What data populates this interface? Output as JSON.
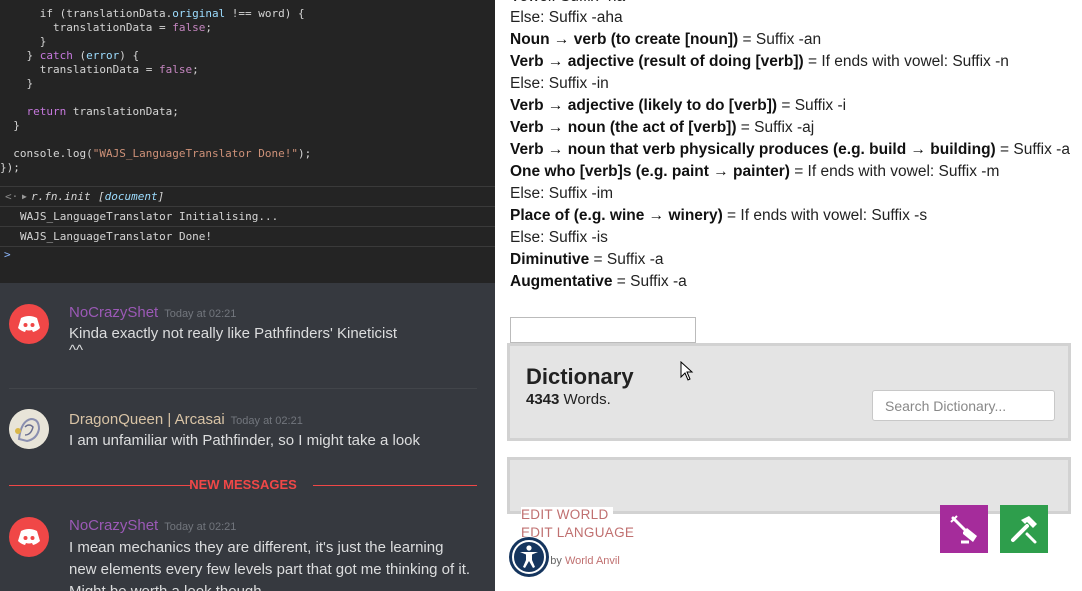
{
  "console": {
    "code_lines": [
      {
        "indent": "      ",
        "parts": [
          [
            "if (translationData.",
            ""
          ],
          [
            "original",
            "prop"
          ],
          [
            " !== word) {",
            ""
          ]
        ]
      },
      {
        "indent": "        ",
        "parts": [
          [
            "translationData = ",
            ""
          ],
          [
            "false",
            "bool"
          ],
          [
            ";",
            ""
          ]
        ]
      },
      {
        "indent": "      ",
        "parts": [
          [
            "}",
            ""
          ]
        ]
      },
      {
        "indent": "    ",
        "parts": [
          [
            "} ",
            ""
          ],
          [
            "catch",
            "kw"
          ],
          [
            " (",
            ""
          ],
          [
            "error",
            "prop"
          ],
          [
            ") {",
            ""
          ]
        ]
      },
      {
        "indent": "      ",
        "parts": [
          [
            "translationData = ",
            ""
          ],
          [
            "false",
            "bool"
          ],
          [
            ";",
            ""
          ]
        ]
      },
      {
        "indent": "    ",
        "parts": [
          [
            "}",
            ""
          ]
        ]
      },
      {
        "indent": "",
        "parts": [
          [
            "",
            ""
          ]
        ]
      },
      {
        "indent": "    ",
        "parts": [
          [
            "return",
            "kw"
          ],
          [
            " translationData;",
            ""
          ]
        ]
      },
      {
        "indent": "  ",
        "parts": [
          [
            "}",
            ""
          ]
        ]
      },
      {
        "indent": "",
        "parts": [
          [
            "",
            ""
          ]
        ]
      },
      {
        "indent": "  ",
        "parts": [
          [
            "console.",
            ""
          ],
          [
            "log",
            ""
          ],
          [
            "(",
            ""
          ],
          [
            "\"WAJS_LanguageTranslator Done!\"",
            "str"
          ],
          [
            ");",
            ""
          ]
        ]
      },
      {
        "indent": "",
        "parts": [
          [
            "});",
            ""
          ]
        ]
      }
    ],
    "result_prefix": "r.fn.init",
    "result_type": "document",
    "output_lines": [
      "WAJS_LanguageTranslator Initialising...",
      "WAJS_LanguageTranslator Done!"
    ],
    "prompt": ">"
  },
  "chat": {
    "messages": [
      {
        "username": "NoCrazyShet",
        "time": "Today at 02:21",
        "lines": [
          "Kinda exactly not really like Pathfinders' Kineticist",
          "^^"
        ]
      },
      {
        "username": "DragonQueen | Arcasai",
        "time": "Today at 02:21",
        "lines": [
          "I am unfamiliar with Pathfinder, so I might take a look"
        ]
      },
      {
        "username": "NoCrazyShet",
        "time": "Today at 02:21",
        "lines": [
          "I mean mechanics they are different, it's just the learning",
          "new elements every few levels part that got me thinking of it.",
          "Might be worth a look though"
        ]
      }
    ],
    "new_messages_label": "NEW MESSAGES"
  },
  "rules": [
    {
      "bold": "",
      "rest": "Else: Suffix -aha"
    },
    {
      "bold": "Noun → verb (to create [noun])",
      "rest": " = Suffix -an"
    },
    {
      "bold": "Verb → adjective (result of doing [verb])",
      "rest": " = If ends with vowel: Suffix -n"
    },
    {
      "bold": "",
      "rest": "Else: Suffix -in"
    },
    {
      "bold": "Verb → adjective (likely to do [verb])",
      "rest": " = Suffix -i"
    },
    {
      "bold": "Verb → noun (the act of [verb])",
      "rest": " = Suffix -aj"
    },
    {
      "bold": "Verb → noun that verb physically produces (e.g. build → building)",
      "rest": " = Suffix -a"
    },
    {
      "bold": "One who [verb]s (e.g. paint → painter)",
      "rest": " = If ends with vowel: Suffix -m"
    },
    {
      "bold": "",
      "rest": "Else: Suffix -im"
    },
    {
      "bold": "Place of (e.g. wine → winery)",
      "rest": " = If ends with vowel: Suffix -s"
    },
    {
      "bold": "",
      "rest": "Else: Suffix -is"
    },
    {
      "bold": "Diminutive",
      "rest": " = Suffix -a"
    },
    {
      "bold": "Augmentative",
      "rest": " = Suffix -a"
    }
  ],
  "top_partial": "Vowel: Suffix -ha",
  "dictionary": {
    "title": "Dictionary",
    "count": "4343",
    "count_suffix": " Words.",
    "search_placeholder": "Search Dictionary..."
  },
  "footer": {
    "edit_world": "EDIT WORLD",
    "edit_language": "EDIT LANGUAGE",
    "powered_prefix": "ed by ",
    "powered_brand": "World Anvil"
  },
  "colors": {
    "accent_link": "#c07070",
    "tool_purple": "#a52c9b",
    "tool_green": "#2e9e4c",
    "discord_red": "#f04747"
  }
}
